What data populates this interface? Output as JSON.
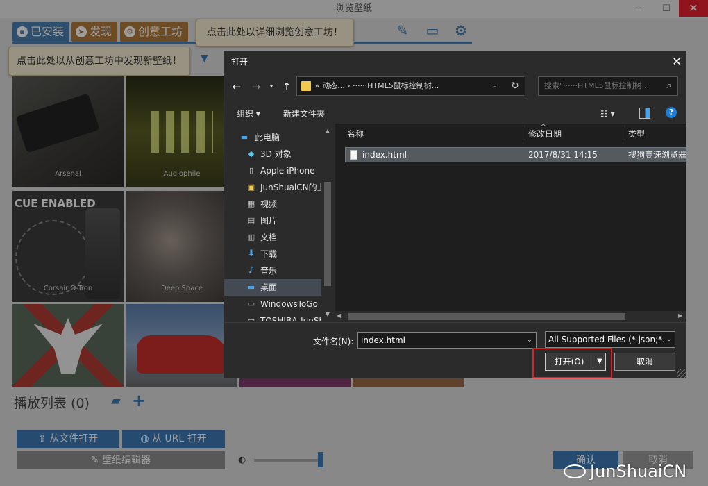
{
  "app": {
    "title": "浏览壁纸",
    "tabs": [
      {
        "label": "已安装",
        "icon": "save-icon"
      },
      {
        "label": "发现",
        "icon": "compass-icon"
      },
      {
        "label": "创意工坊",
        "icon": "steam-icon"
      }
    ],
    "toolbar_icons": [
      "wand-icon",
      "monitor-icon",
      "gear-icon"
    ],
    "tooltip_workshop": "点击此处以详细浏览创意工坊！",
    "tooltip_discover": "点击此处以从创意工坊中发现新壁纸！",
    "thumbnails": [
      {
        "label": "Arsenal"
      },
      {
        "label": "Audiophile"
      },
      {
        "label": "Corsair O-Tron",
        "badge": "CUE ENABLED"
      },
      {
        "label": "Deep Space"
      }
    ],
    "playlist_title": "播放列表 (0)",
    "buttons": {
      "open_file": "从文件打开",
      "open_url": "从 URL 打开",
      "editor": "壁纸编辑器",
      "confirm": "确认",
      "cancel": "取消"
    },
    "colors": {
      "accent": "#3d7ab5",
      "workshop": "#b07a3a"
    }
  },
  "dialog": {
    "title": "打开",
    "address": "« 动态... › ······HTML5鼠标控制树...",
    "search_placeholder": "搜索\"······HTML5鼠标控制树...",
    "toolbar": {
      "organize": "组织 ▾",
      "new_folder": "新建文件夹"
    },
    "nav_items": [
      {
        "label": "此电脑",
        "icon": "computer-icon",
        "indent": 0
      },
      {
        "label": "3D 对象",
        "icon": "cube-icon",
        "indent": 1
      },
      {
        "label": "Apple iPhone",
        "icon": "phone-icon",
        "indent": 1
      },
      {
        "label": "JunShuaiCN的上",
        "icon": "device-icon",
        "indent": 1
      },
      {
        "label": "视频",
        "icon": "video-icon",
        "indent": 1
      },
      {
        "label": "图片",
        "icon": "picture-icon",
        "indent": 1
      },
      {
        "label": "文档",
        "icon": "document-icon",
        "indent": 1
      },
      {
        "label": "下载",
        "icon": "download-icon",
        "indent": 1
      },
      {
        "label": "音乐",
        "icon": "music-icon",
        "indent": 1
      },
      {
        "label": "桌面",
        "icon": "desktop-icon",
        "indent": 1,
        "selected": true
      },
      {
        "label": "WindowsToGo",
        "icon": "drive-icon",
        "indent": 1
      },
      {
        "label": "TOSHIBA-JunSh",
        "icon": "drive-icon",
        "indent": 1
      }
    ],
    "columns": {
      "name": "名称",
      "date": "修改日期",
      "type": "类型"
    },
    "files": [
      {
        "name": "index.html",
        "date": "2017/8/31 14:15",
        "type": "搜狗高速浏览器"
      }
    ],
    "filename_label": "文件名(N):",
    "filename_value": "index.html",
    "filetype": "All Supported Files (*.json;*.p",
    "open_button": "打开(O)",
    "cancel_button": "取消"
  },
  "watermark": "JunShuaiCN"
}
